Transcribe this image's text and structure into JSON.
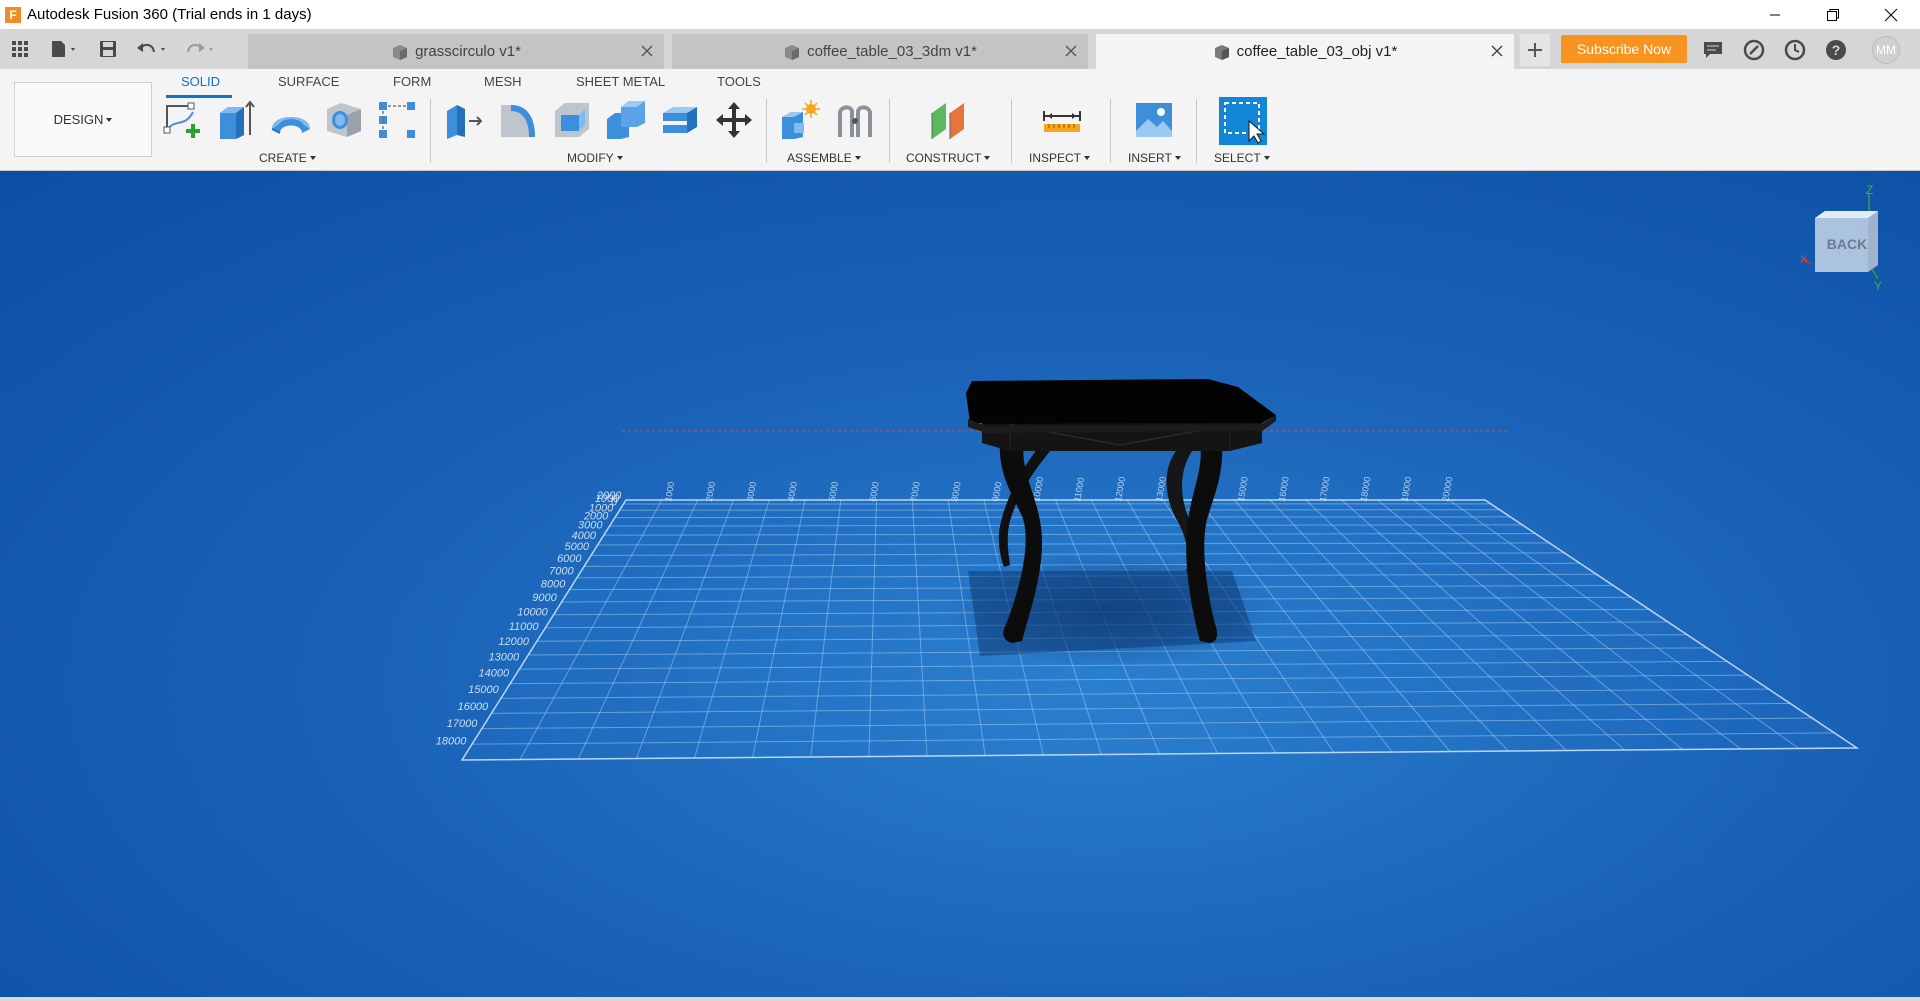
{
  "window": {
    "app_logo": "F",
    "title": "Autodesk Fusion 360 (Trial ends in 1 days)"
  },
  "tabs": [
    {
      "label": "grasscirculo v1*",
      "active": false
    },
    {
      "label": "coffee_table_03_3dm v1*",
      "active": false
    },
    {
      "label": "coffee_table_03_obj v1*",
      "active": true
    }
  ],
  "account": {
    "subscribe_label": "Subscribe Now",
    "initials": "MM"
  },
  "workspace": {
    "label": "DESIGN"
  },
  "ribbon": {
    "tabs": [
      "SOLID",
      "SURFACE",
      "FORM",
      "MESH",
      "SHEET METAL",
      "TOOLS"
    ],
    "active_tab": "SOLID",
    "groups": [
      "CREATE",
      "MODIFY",
      "ASSEMBLE",
      "CONSTRUCT",
      "INSPECT",
      "INSERT",
      "SELECT"
    ]
  },
  "viewcube": {
    "face_label": "BACK",
    "axes": {
      "z": "Z",
      "x": "X",
      "y": "Y"
    }
  },
  "grid": {
    "left_labels": [
      "2000",
      "1000",
      "0",
      "1000",
      "2000",
      "3000",
      "4000",
      "5000",
      "6000",
      "7000",
      "8000",
      "9000",
      "10000",
      "11000",
      "12000",
      "13000",
      "14000",
      "15000",
      "16000",
      "17000",
      "18000"
    ],
    "top_labels": [
      "1000",
      "2000",
      "3000",
      "4000",
      "5000",
      "6000",
      "7000",
      "8000",
      "9000",
      "10000",
      "11000",
      "12000",
      "13000",
      "14000",
      "15000",
      "16000",
      "17000",
      "18000",
      "19000",
      "20000"
    ]
  },
  "colors": {
    "accent": "#0e74c7",
    "subscribe": "#f7931e",
    "viewport_bg": "#1a63b8",
    "model": "#0a0a0a"
  }
}
